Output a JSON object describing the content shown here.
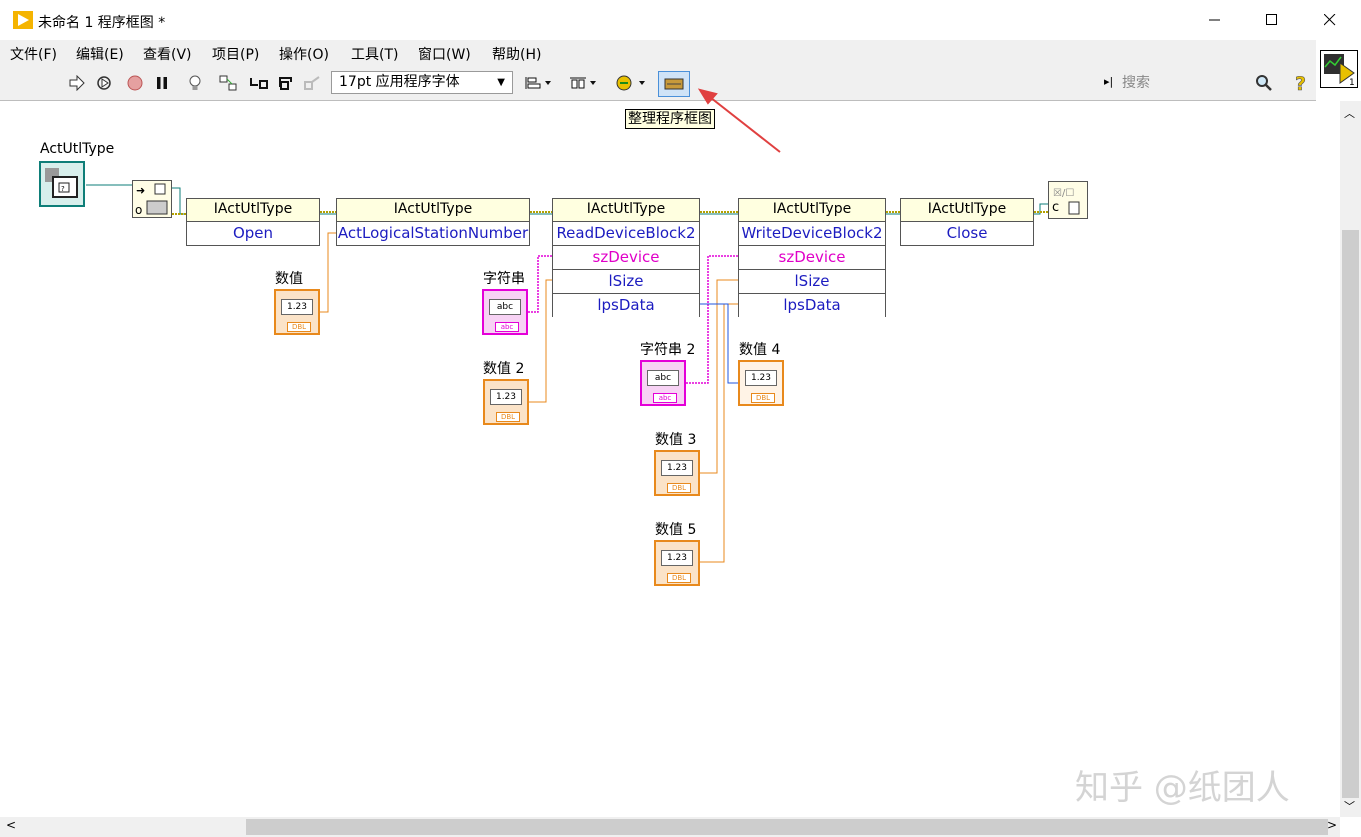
{
  "window": {
    "title": "未命名 1 程序框图 *"
  },
  "menu": [
    "文件(F)",
    "编辑(E)",
    "查看(V)",
    "项目(P)",
    "操作(O)",
    "工具(T)",
    "窗口(W)",
    "帮助(H)"
  ],
  "toolbar": {
    "font_select": "17pt 应用程序字体",
    "search_placeholder": "搜索",
    "tooltip": "整理程序框图"
  },
  "diagram": {
    "constant_label": "ActUtlType",
    "nodes": {
      "open": {
        "class": "IActUtlType",
        "prop": "Open"
      },
      "station": {
        "class": "IActUtlType",
        "prop": "ActLogicalStationNumber"
      },
      "read": {
        "class": "IActUtlType",
        "method": "ReadDeviceBlock2",
        "params": [
          "szDevice",
          "lSize",
          "lpsData"
        ]
      },
      "write": {
        "class": "IActUtlType",
        "method": "WriteDeviceBlock2",
        "params": [
          "szDevice",
          "lSize",
          "lpsData"
        ]
      },
      "close": {
        "class": "IActUtlType",
        "prop": "Close"
      }
    },
    "controls": {
      "num1": {
        "label": "数值",
        "value": "1.23",
        "type": "DBL"
      },
      "str1": {
        "label": "字符串",
        "value": "abc",
        "type": "abc"
      },
      "num2": {
        "label": "数值 2",
        "value": "1.23",
        "type": "DBL"
      },
      "str2": {
        "label": "字符串 2",
        "value": "abc",
        "type": "abc"
      },
      "num3": {
        "label": "数值 3",
        "value": "1.23",
        "type": "DBL"
      },
      "num4": {
        "label": "数值 4",
        "value": "1.23",
        "type": "DBL"
      },
      "num5": {
        "label": "数值 5",
        "value": "1.23",
        "type": "DBL"
      }
    },
    "close_ref_label": "c"
  },
  "watermark": "知乎 @纸团人"
}
